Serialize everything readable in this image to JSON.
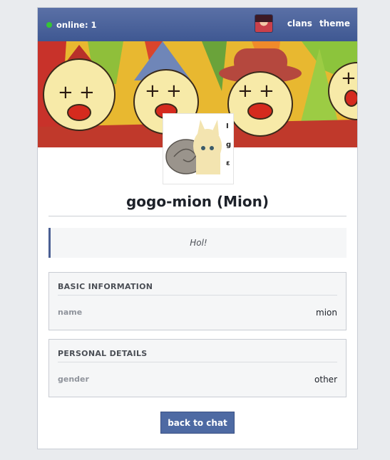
{
  "topbar": {
    "online_label": "online: 1",
    "nav_items": [
      "clans",
      "theme"
    ]
  },
  "profile": {
    "display_name": "gogo-mion (Mion)",
    "status_message": "Hol!"
  },
  "sections": [
    {
      "title": "BASIC INFORMATION",
      "field_label": "name",
      "field_value": "mion"
    },
    {
      "title": "PERSONAL DETAILS",
      "field_label": "gender",
      "field_value": "other"
    }
  ],
  "actions": {
    "back_label": "back to chat"
  },
  "colors": {
    "topbar": "#3f5892",
    "accent": "#4b5f93",
    "online_dot": "#35c535",
    "page_bg": "#e9ebee"
  }
}
